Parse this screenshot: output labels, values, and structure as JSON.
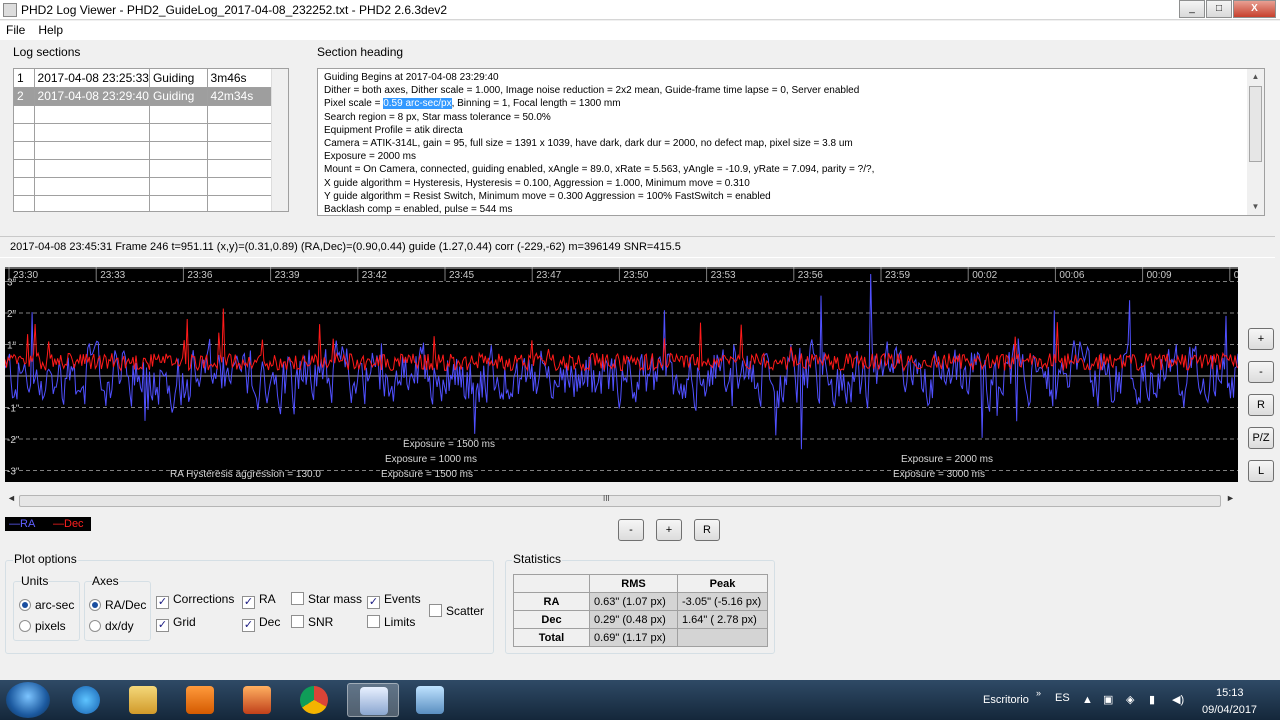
{
  "window": {
    "title": "PHD2 Log Viewer - PHD2_GuideLog_2017-04-08_232252.txt - PHD2 2.6.3dev2",
    "min": "_",
    "max": "□",
    "close": "X"
  },
  "menu": [
    "File",
    "Help"
  ],
  "log_sections": {
    "label": "Log sections",
    "rows": [
      [
        "1",
        "2017-04-08 23:25:33",
        "Guiding",
        "3m46s"
      ],
      [
        "2",
        "2017-04-08 23:29:40",
        "Guiding",
        "42m34s"
      ]
    ],
    "selected_row": 1
  },
  "section_heading": {
    "label": "Section heading",
    "lines": [
      "Guiding Begins at 2017-04-08 23:29:40",
      "Dither = both axes, Dither scale = 1.000, Image noise reduction = 2x2 mean, Guide-frame time lapse = 0, Server enabled",
      "Binning = 1, Focal length = 1300 mm",
      "Search region = 8 px, Star mass tolerance = 50.0%",
      "Equipment Profile = atik directa",
      "Camera = ATIK-314L, gain = 95, full size = 1391 x 1039, have dark, dark dur = 2000, no defect map, pixel size = 3.8 um",
      "Exposure = 2000 ms",
      "Mount = On Camera,  connected, guiding enabled, xAngle = 89.0, xRate = 5.563, yAngle = -10.9, yRate = 7.094, parity = ?/?,",
      "X guide algorithm = Hysteresis, Hysteresis = 0.100, Aggression = 1.000, Minimum move = 0.310",
      "Y guide algorithm = Resist Switch, Minimum move = 0.300 Aggression = 100% FastSwitch = enabled",
      "Backlash comp = enabled, pulse = 544 ms"
    ],
    "pixel_scale_prefix": "Pixel scale = ",
    "pixel_scale_value": "0.59 arc-sec/px"
  },
  "status_line": "2017-04-08 23:45:31 Frame 246 t=951.11 (x,y)=(0.31,0.89) (RA,Dec)=(0.90,0.44) guide (1.27,0.44) corr (-229,-62) m=396149 SNR=415.5",
  "graph": {
    "time_labels": [
      "23:30",
      "23:33",
      "23:36",
      "23:39",
      "23:42",
      "23:45",
      "23:47",
      "23:50",
      "23:53",
      "23:56",
      "23:59",
      "00:02",
      "00:06",
      "00:09",
      "00"
    ],
    "y_labels": [
      "3\"",
      "2\"",
      "1\"",
      "-1\"",
      "-2\"",
      "-3\""
    ],
    "events": [
      "Exposure = 1500 ms",
      "Exposure = 1000 ms",
      "RA Hysteresis aggression = 130.0",
      "Exposure = 1500 ms",
      "Exposure = 2000 ms",
      "Exposure = 3000 ms"
    ],
    "colors": {
      "ra": "#5050ff",
      "dec": "#ff1a1a",
      "grid": "#808080",
      "bg": "#000000"
    }
  },
  "scroll_grip": "III",
  "side_buttons": [
    "+",
    "-",
    "R",
    "P/Z",
    "L"
  ],
  "bottom_buttons": [
    "-",
    "+",
    "R"
  ],
  "legend": {
    "ra": "—RA",
    "dec": "—Dec"
  },
  "plot_options": {
    "label": "Plot options",
    "units_label": "Units",
    "units": [
      {
        "label": "arc-sec",
        "on": true
      },
      {
        "label": "pixels",
        "on": false
      }
    ],
    "axes_label": "Axes",
    "axes": [
      {
        "label": "RA/Dec",
        "on": true
      },
      {
        "label": "dx/dy",
        "on": false
      }
    ],
    "checks": {
      "corrections": "Corrections",
      "grid": "Grid",
      "ra": "RA",
      "dec": "Dec",
      "star_mass": "Star mass",
      "snr": "SNR",
      "events": "Events",
      "limits": "Limits",
      "scatter": "Scatter"
    }
  },
  "statistics": {
    "label": "Statistics",
    "headers": [
      "RMS",
      "Peak"
    ],
    "rows": [
      {
        "name": "RA",
        "rms": "0.63\" (1.07 px)",
        "peak": "-3.05\" (-5.16 px)"
      },
      {
        "name": "Dec",
        "rms": "0.29\" (0.48 px)",
        "peak": "1.64\" ( 2.78 px)"
      },
      {
        "name": "Total",
        "rms": "0.69\" (1.17 px)",
        "peak": ""
      }
    ]
  },
  "taskbar": {
    "desktop": "Escritorio",
    "lang": "ES",
    "time": "15:13",
    "date": "09/04/2017"
  }
}
